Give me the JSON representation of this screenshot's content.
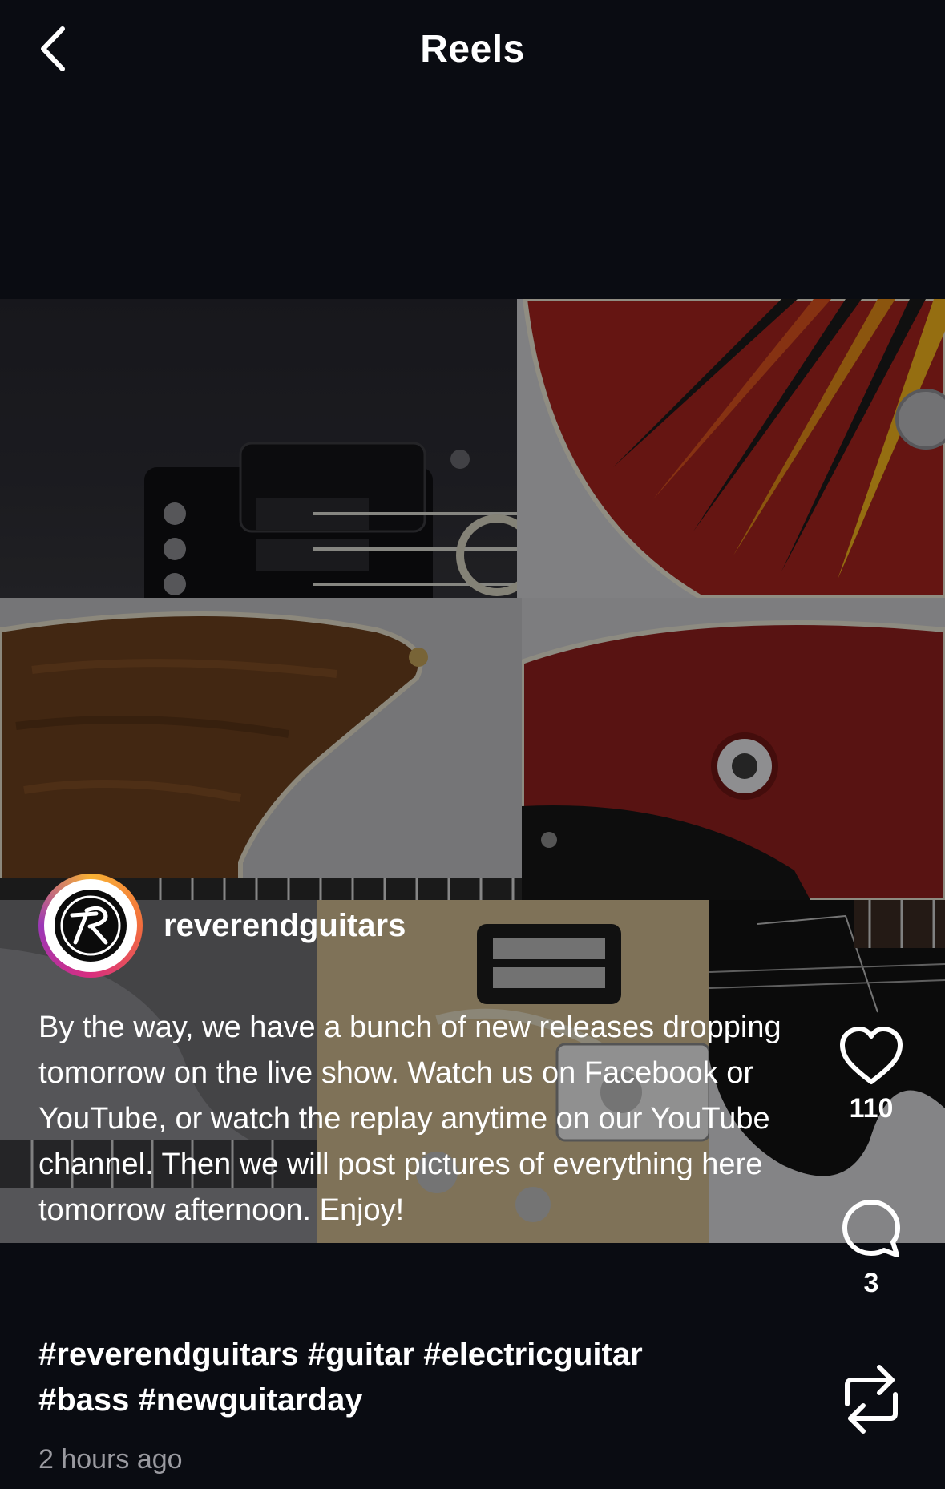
{
  "header": {
    "title": "Reels"
  },
  "post": {
    "username": "reverendguitars",
    "caption": "By the way, we have a bunch of new releases dropping tomorrow on the live show. Watch us on Facebook or YouTube, or watch the replay anytime on our YouTube channel. Then we will post pictures of everything here tomorrow afternoon. Enjoy!",
    "hashtags": [
      "#reverendguitars",
      "#guitar",
      "#electricguitar",
      "#bass",
      "#newguitarday"
    ],
    "time": "2 hours ago"
  },
  "actions": {
    "likes": "110",
    "comments": "3"
  },
  "icons": {
    "back": "chevron-left-icon",
    "like": "heart-icon",
    "comment": "comment-bubble-icon",
    "remix": "repost-icon"
  },
  "colors": {
    "background": "#0a0c12",
    "text": "#ffffff",
    "muted": "#9a9aa0",
    "ring_gradient": [
      "#f9b233",
      "#f26d3d",
      "#d92e7f",
      "#9b36b7"
    ]
  }
}
